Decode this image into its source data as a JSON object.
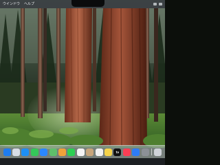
{
  "menubar": {
    "items": [
      "ウインドウ",
      "ヘルプ"
    ]
  },
  "dock": {
    "apps": [
      {
        "name": "finder-icon",
        "color": "#1e7cf0"
      },
      {
        "name": "launchpad-icon",
        "color": "#d7dde6"
      },
      {
        "name": "safari-icon",
        "color": "#1d8ff5"
      },
      {
        "name": "messages-icon",
        "color": "#34c759"
      },
      {
        "name": "mail-icon",
        "color": "#2a87ff"
      },
      {
        "name": "maps-icon",
        "color": "#5fbf6b"
      },
      {
        "name": "photos-icon",
        "color": "#f0a23a"
      },
      {
        "name": "facetime-icon",
        "color": "#2ccf52"
      },
      {
        "name": "calendar-icon",
        "color": "#f4f4f4"
      },
      {
        "name": "contacts-icon",
        "color": "#c7a57b"
      },
      {
        "name": "reminders-icon",
        "color": "#f1f1f1"
      },
      {
        "name": "notes-icon",
        "color": "#f5d34a"
      },
      {
        "name": "appletv-icon",
        "color": "#111111",
        "label": "tv"
      },
      {
        "name": "music-icon",
        "color": "#fb3e55"
      },
      {
        "name": "appstore-icon",
        "color": "#2d7cf6"
      },
      {
        "name": "settings-icon",
        "color": "#8c9096"
      },
      {
        "name": "trash-icon",
        "color": "#cfd3d8"
      }
    ]
  }
}
